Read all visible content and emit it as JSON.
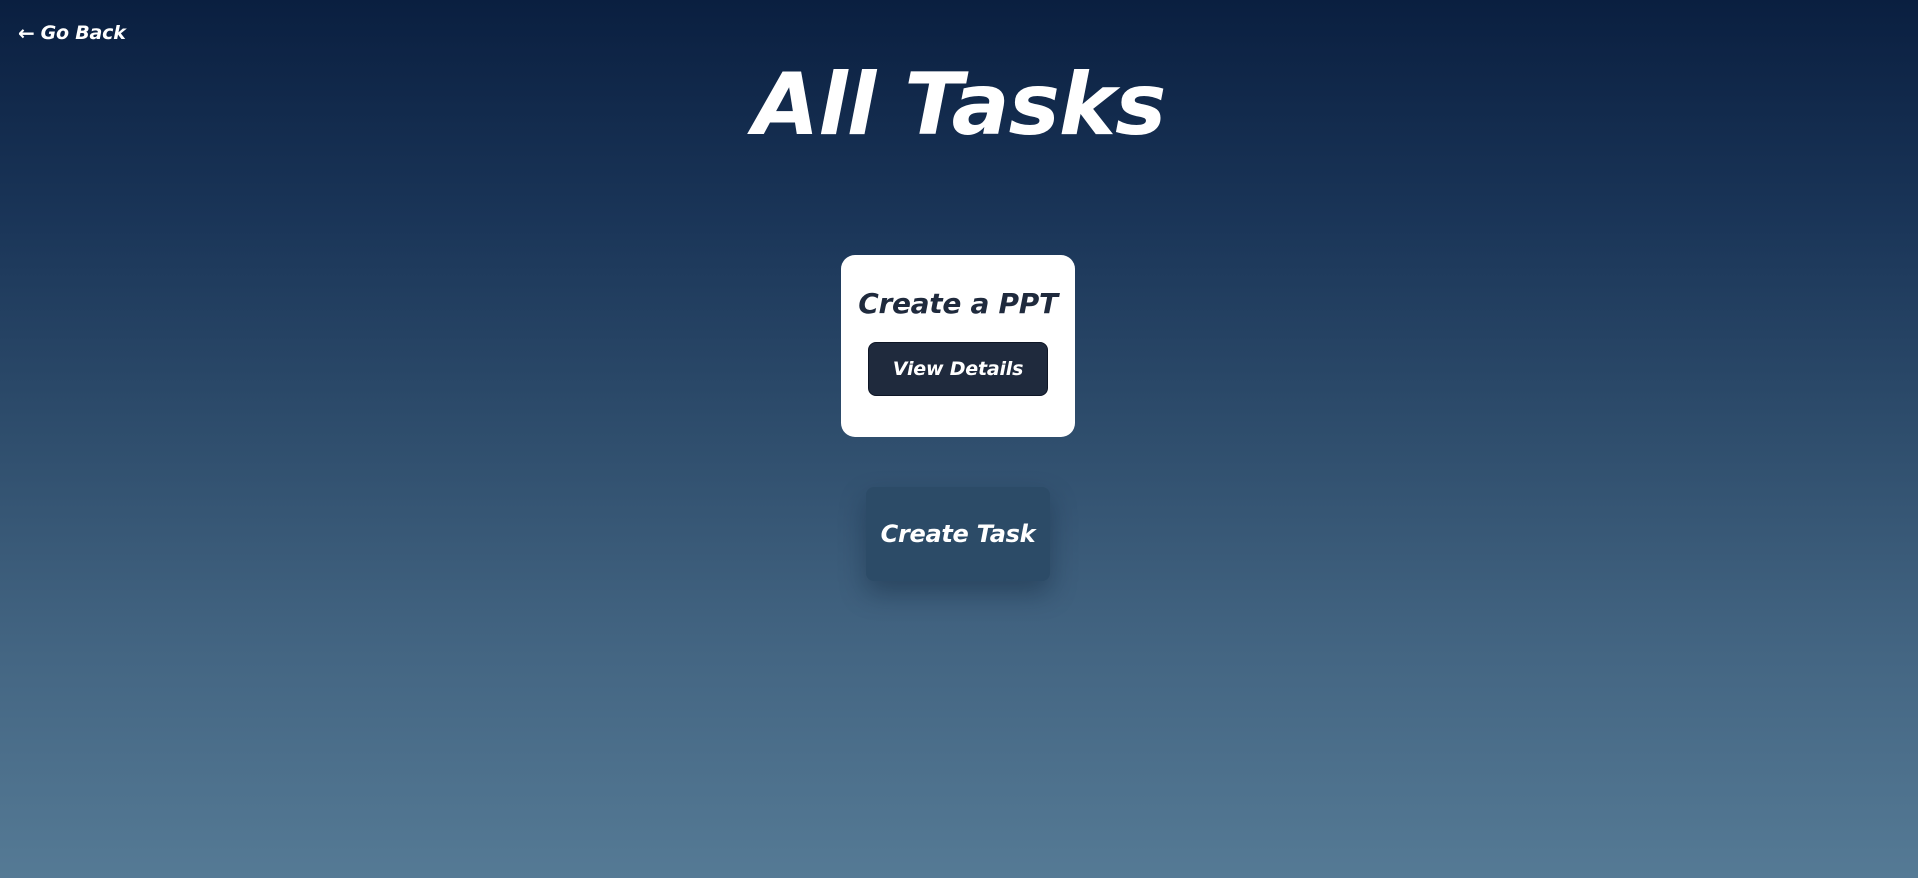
{
  "header": {
    "back_label": "Go Back",
    "back_icon": "arrow-left-icon",
    "title": "All Tasks"
  },
  "tasks": [
    {
      "title": "Create a PPT",
      "action_label": "View Details"
    }
  ],
  "actions": {
    "create_task_label": "Create Task"
  },
  "colors": {
    "background_top": "#0a1f40",
    "background_bottom": "#557a95",
    "card_background": "#ffffff",
    "card_text": "#1f2a3d",
    "primary_button": "#1f2a3d",
    "create_button": "#2c4b67"
  }
}
